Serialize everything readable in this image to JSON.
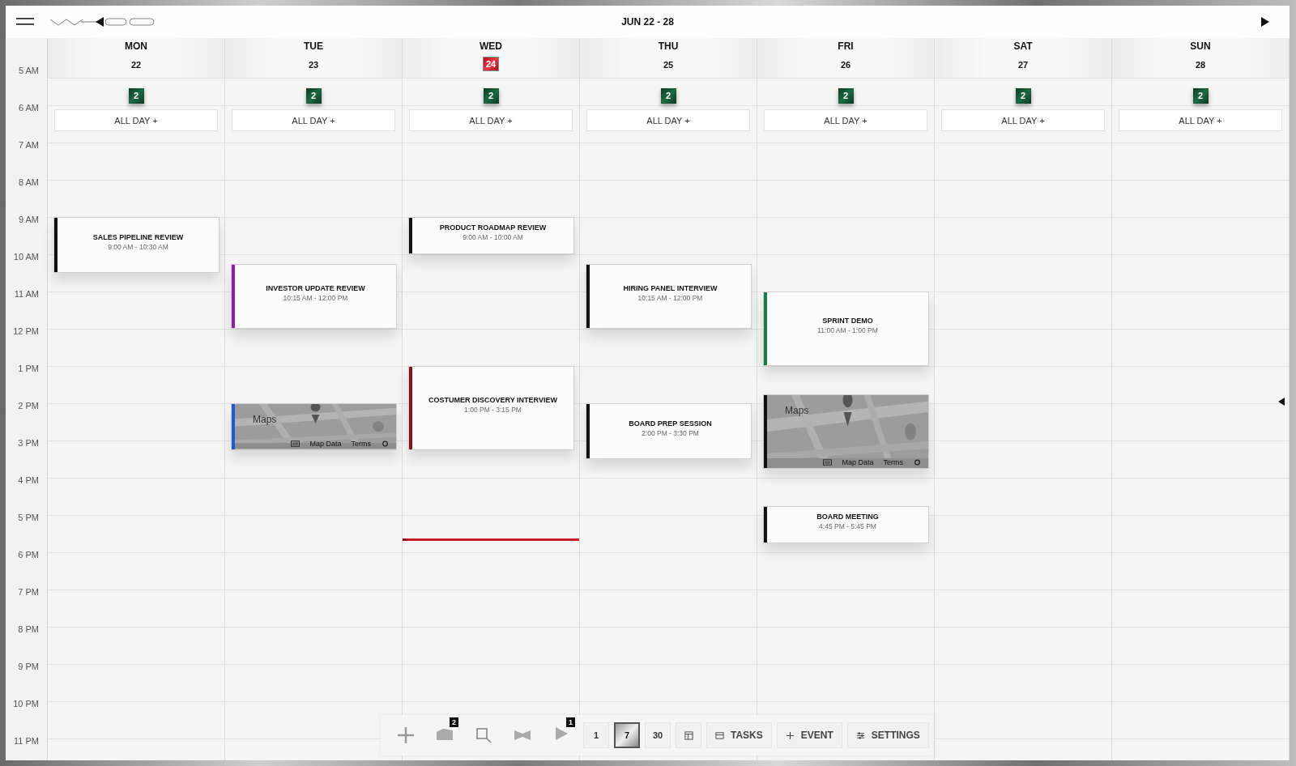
{
  "top_bar": {
    "title": "JUN 22 - 28"
  },
  "time_labels": [
    "5 AM",
    "6 AM",
    "7 AM",
    "8 AM",
    "9 AM",
    "10 AM",
    "11 AM",
    "12 PM",
    "1 PM",
    "2 PM",
    "3 PM",
    "4 PM",
    "5 PM",
    "6 PM",
    "7 PM",
    "8 PM",
    "9 PM",
    "10 PM",
    "11 PM"
  ],
  "days": [
    {
      "name": "MON",
      "date": "22",
      "today": false,
      "count": "2",
      "all_day": "ALL DAY +",
      "events": [
        {
          "kind": "event",
          "title": "SALES PIPELINE REVIEW",
          "time": "9:00 AM - 10:30 AM",
          "color": "#111111"
        }
      ]
    },
    {
      "name": "TUE",
      "date": "23",
      "today": false,
      "count": "2",
      "all_day": "ALL DAY +",
      "events": [
        {
          "kind": "event",
          "title": "INVESTOR UPDATE REVIEW",
          "time": "10:15 AM - 12:00 PM",
          "color": "#8e1fa0"
        },
        {
          "kind": "map",
          "link": "Maps",
          "attribution": [
            "Map Data",
            "Terms"
          ],
          "color": "#2456d8"
        }
      ]
    },
    {
      "name": "WED",
      "date": "24",
      "today": true,
      "count": "2",
      "all_day": "ALL DAY +",
      "events": [
        {
          "kind": "event",
          "title": "PRODUCT ROADMAP REVIEW",
          "time": "9:00 AM - 10:00 AM",
          "color": "#111111"
        },
        {
          "kind": "event",
          "title": "COSTUMER DISCOVERY INTERVIEW",
          "time": "1:00 PM - 3:15 PM",
          "color": "#8a0f1e"
        }
      ]
    },
    {
      "name": "THU",
      "date": "25",
      "today": false,
      "count": "2",
      "all_day": "ALL DAY +",
      "events": [
        {
          "kind": "event",
          "title": "HIRING PANEL INTERVIEW",
          "time": "10:15 AM - 12:00 PM",
          "color": "#111111"
        },
        {
          "kind": "event",
          "title": "BOARD PREP SESSION",
          "time": "2:00 PM - 3:30 PM",
          "color": "#111111"
        }
      ]
    },
    {
      "name": "FRI",
      "date": "26",
      "today": false,
      "count": "2",
      "all_day": "ALL DAY +",
      "events": [
        {
          "kind": "event",
          "title": "SPRINT DEMO",
          "time": "11:00 AM - 1:00 PM",
          "color": "#1a7a4c"
        },
        {
          "kind": "map",
          "link": "Maps",
          "attribution": [
            "Map Data",
            "Terms"
          ],
          "color": "#111111"
        },
        {
          "kind": "event",
          "title": "BOARD MEETING",
          "time": "4:45 PM - 5:45 PM",
          "color": "#111111"
        }
      ]
    },
    {
      "name": "SAT",
      "date": "27",
      "today": false,
      "count": "2",
      "all_day": "ALL DAY +"
    },
    {
      "name": "SUN",
      "date": "28",
      "today": false,
      "count": "2",
      "all_day": "ALL DAY +"
    }
  ],
  "toolbar": {
    "layers_badge": "2",
    "play_badge": "1",
    "views": [
      {
        "label": "1",
        "selected": false
      },
      {
        "label": "7",
        "selected": true
      },
      {
        "label": "30",
        "selected": false
      }
    ],
    "actions": [
      {
        "kind": "tasks",
        "label": "TASKS"
      },
      {
        "kind": "event",
        "label": "EVENT"
      },
      {
        "kind": "settings",
        "label": "SETTINGS"
      }
    ]
  }
}
